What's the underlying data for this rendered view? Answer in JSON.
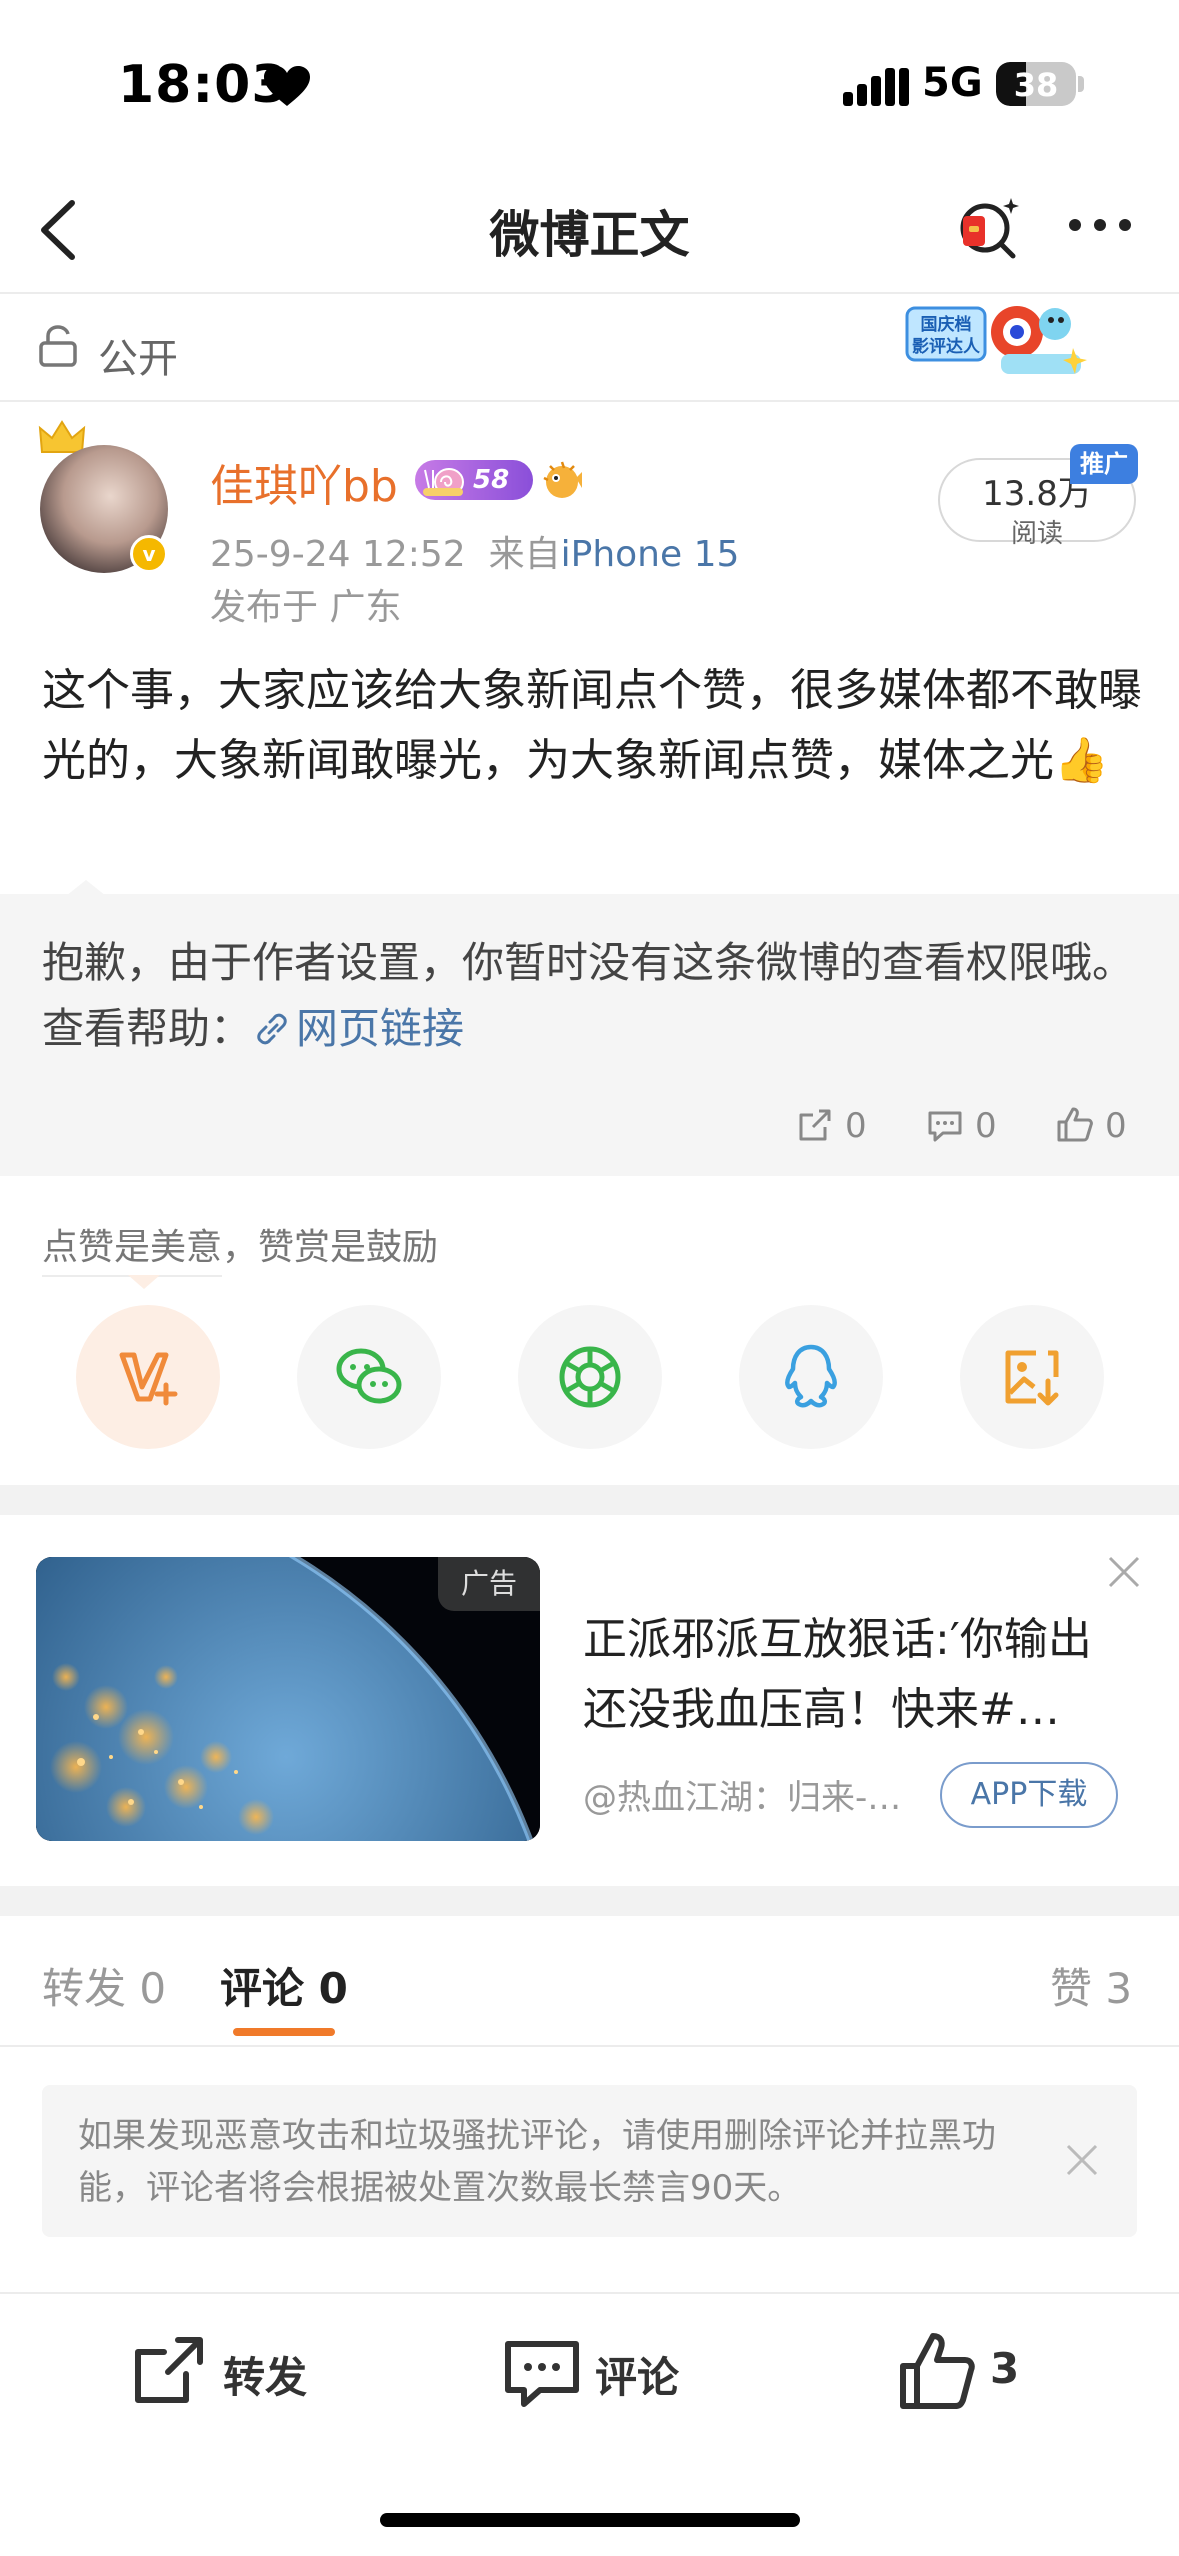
{
  "status_bar": {
    "time": "18:03",
    "network": "5G",
    "battery": "38",
    "battery_level": 0.38
  },
  "nav": {
    "title": "微博正文"
  },
  "visibility": {
    "label": "公开",
    "badge_text": "国庆档影评达人"
  },
  "author": {
    "name": "佳琪吖bb",
    "level": "58",
    "date": "25-9-24 12:52",
    "source_prefix": "来自",
    "source": "iPhone 15",
    "location": "发布于 广东",
    "reads_count": "13.8万",
    "reads_label": "阅读",
    "promo_tag": "推广"
  },
  "post": {
    "text": "这个事，大家应该给大象新闻点个赞，很多媒体都不敢曝光的，大象新闻敢曝光，为大象新闻点赞，媒体之光👍"
  },
  "repost": {
    "text": "抱歉，由于作者设置，你暂时没有这条微博的查看权限哦。查看帮助：",
    "link": "网页链接",
    "forwards": "0",
    "comments": "0",
    "likes": "0"
  },
  "reward": {
    "label": "点赞是美意，赞赏是鼓励",
    "icons": [
      "reward-v-icon",
      "wechat-icon",
      "moments-icon",
      "qq-icon",
      "save-image-icon"
    ]
  },
  "ad": {
    "tag": "广告",
    "title": "正派邪派互放狠话:′你输出还没我血压高！快来#…",
    "advertiser": "@热血江湖：归来-…",
    "button": "APP下载"
  },
  "tabs": {
    "forward": "转发 0",
    "comment": "评论 0",
    "like": "赞 3"
  },
  "notice": {
    "text": "如果发现恶意攻击和垃圾骚扰评论，请使用删除评论并拉黑功能，评论者将会根据被处置次数最长禁言90天。"
  },
  "bottom_bar": {
    "forward": "转发",
    "comment": "评论",
    "like": "3"
  },
  "colors": {
    "accent": "#f07a2a",
    "link": "#4a76a8",
    "username": "#e8702b"
  }
}
